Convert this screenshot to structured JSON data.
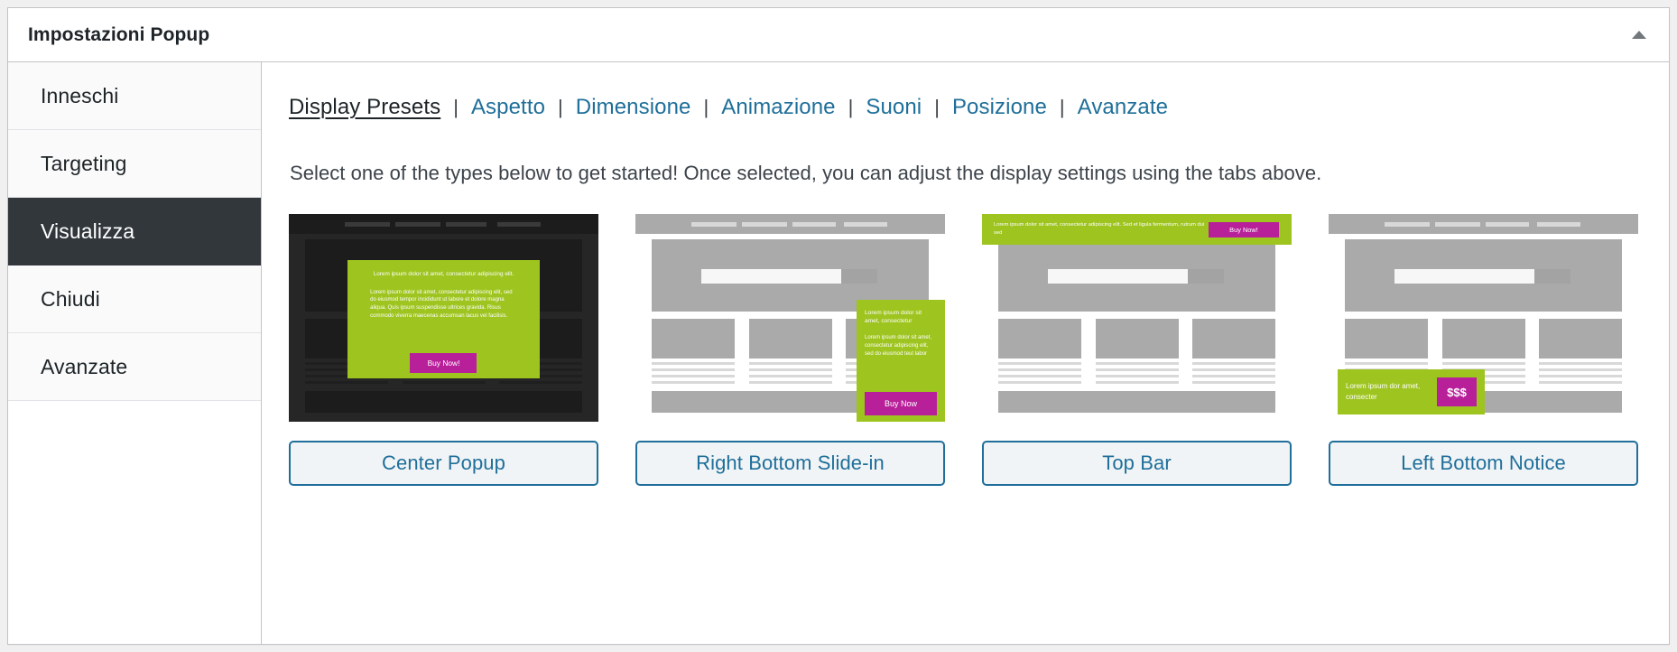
{
  "panel": {
    "title": "Impostazioni Popup",
    "toggle_icon": "caret-up-icon"
  },
  "sidebar": {
    "items": [
      {
        "label": "Inneschi",
        "active": false
      },
      {
        "label": "Targeting",
        "active": false
      },
      {
        "label": "Visualizza",
        "active": true
      },
      {
        "label": "Chiudi",
        "active": false
      },
      {
        "label": "Avanzate",
        "active": false
      }
    ]
  },
  "tabs": {
    "separator": "|",
    "items": [
      {
        "label": "Display Presets",
        "active": true
      },
      {
        "label": "Aspetto",
        "active": false
      },
      {
        "label": "Dimensione",
        "active": false
      },
      {
        "label": "Animazione",
        "active": false
      },
      {
        "label": "Suoni",
        "active": false
      },
      {
        "label": "Posizione",
        "active": false
      },
      {
        "label": "Avanzate",
        "active": false
      }
    ]
  },
  "main": {
    "hint": "Select one of the types below to get started! Once selected, you can adjust the display settings using the tabs above."
  },
  "colors": {
    "accent_link": "#1f6f9a",
    "sidebar_active_bg": "#32373c",
    "promo_green": "#9ec41f",
    "promo_magenta": "#b8209a",
    "mockup_dark": "#262626",
    "mockup_gray": "#aaaaaa"
  },
  "presets": [
    {
      "button_label": "Center Popup",
      "theme": "dark",
      "popup": {
        "heading": "Lorem ipsum dolor sit amet, consectetur adipiscing elit.",
        "body": "Lorem ipsum dolor sit amet, consectetur adipiscing elit, sed do eiusmod tempor incididunt ut labore et dolore magna aliqua. Quis ipsum suspendisse ultrices gravida. Risus commodo viverra maecenas accumsan lacus vel facilisis.",
        "cta": "Buy Now!"
      }
    },
    {
      "button_label": "Right Bottom Slide-in",
      "theme": "light",
      "popup": {
        "heading": "Lorem ipsum dolor sit amet, consectetur",
        "body": "Lorem ipsum dolor sit amet, consectetur adipiscing elit, sed do eiusmod teut labor",
        "cta": "Buy Now"
      }
    },
    {
      "button_label": "Top Bar",
      "theme": "light",
      "popup": {
        "heading": "Lorem ipsum dolor sit amet, consectetur adipiscing elit. Sed et ligula fermentum, rutrum dui sed",
        "body": "",
        "cta": "Buy Now!"
      }
    },
    {
      "button_label": "Left Bottom Notice",
      "theme": "light",
      "popup": {
        "heading": "Lorem ipsum dor amet, consecter",
        "body": "",
        "cta": "$$$"
      }
    }
  ]
}
